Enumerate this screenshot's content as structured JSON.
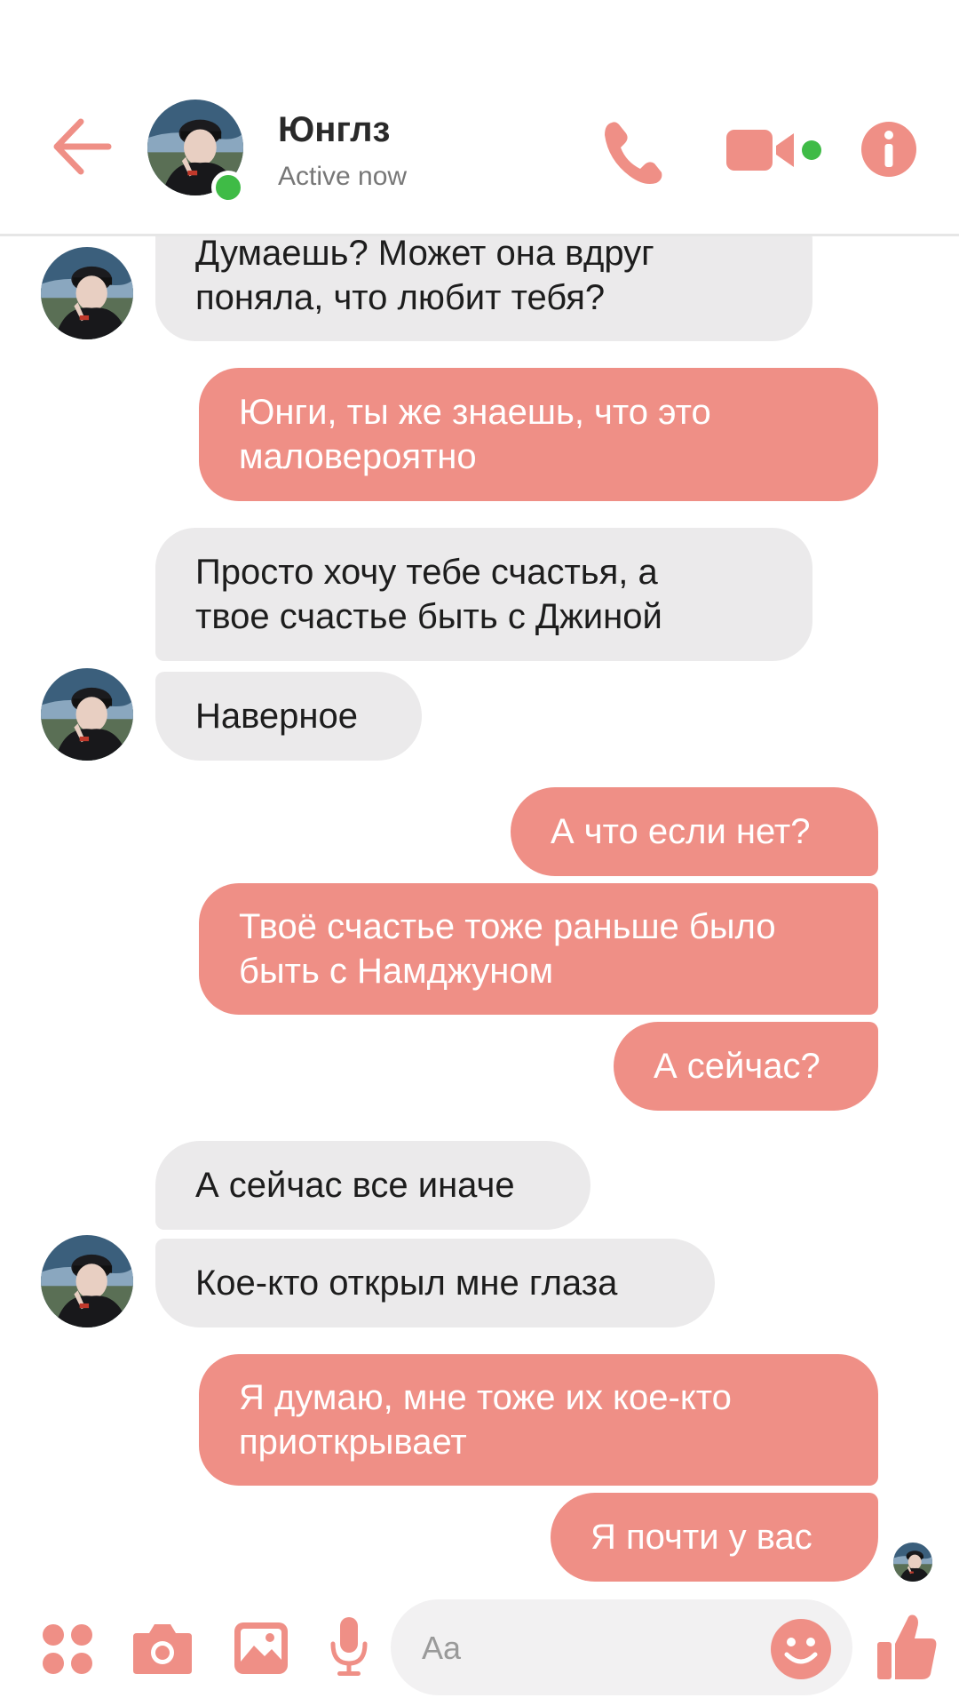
{
  "header": {
    "contact_name": "Юнглз",
    "status": "Active now",
    "accent_color": "#ef8f86",
    "online_color": "#3fbb46"
  },
  "messages": [
    {
      "side": "incoming",
      "text_lines": [
        "Думаешь? Может она вдруг",
        "поняла, что любит тебя?"
      ]
    },
    {
      "side": "outgoing",
      "text_lines": [
        "Юнги, ты же знаешь, что это",
        "маловероятно"
      ]
    },
    {
      "side": "incoming",
      "text_lines": [
        "Просто хочу тебе счастья, а",
        "твое счастье быть с Джиной"
      ]
    },
    {
      "side": "incoming",
      "text_lines": [
        "Наверное"
      ]
    },
    {
      "side": "outgoing",
      "text_lines": [
        "А что если нет?"
      ]
    },
    {
      "side": "outgoing",
      "text_lines": [
        "Твоё счастье тоже раньше было",
        "быть с Намджуном"
      ]
    },
    {
      "side": "outgoing",
      "text_lines": [
        "А сейчас?"
      ]
    },
    {
      "side": "incoming",
      "text_lines": [
        "А сейчас все иначе"
      ]
    },
    {
      "side": "incoming",
      "text_lines": [
        "Кое-кто открыл мне глаза"
      ]
    },
    {
      "side": "outgoing",
      "text_lines": [
        "Я думаю, мне тоже их кое-кто",
        "приоткрывает"
      ]
    },
    {
      "side": "outgoing",
      "text_lines": [
        "Я почти у вас"
      ]
    }
  ],
  "composer": {
    "placeholder": "Aa",
    "icons": [
      "apps-icon",
      "camera-icon",
      "gallery-icon",
      "microphone-icon",
      "emoji-icon",
      "thumbs-up-icon"
    ]
  }
}
